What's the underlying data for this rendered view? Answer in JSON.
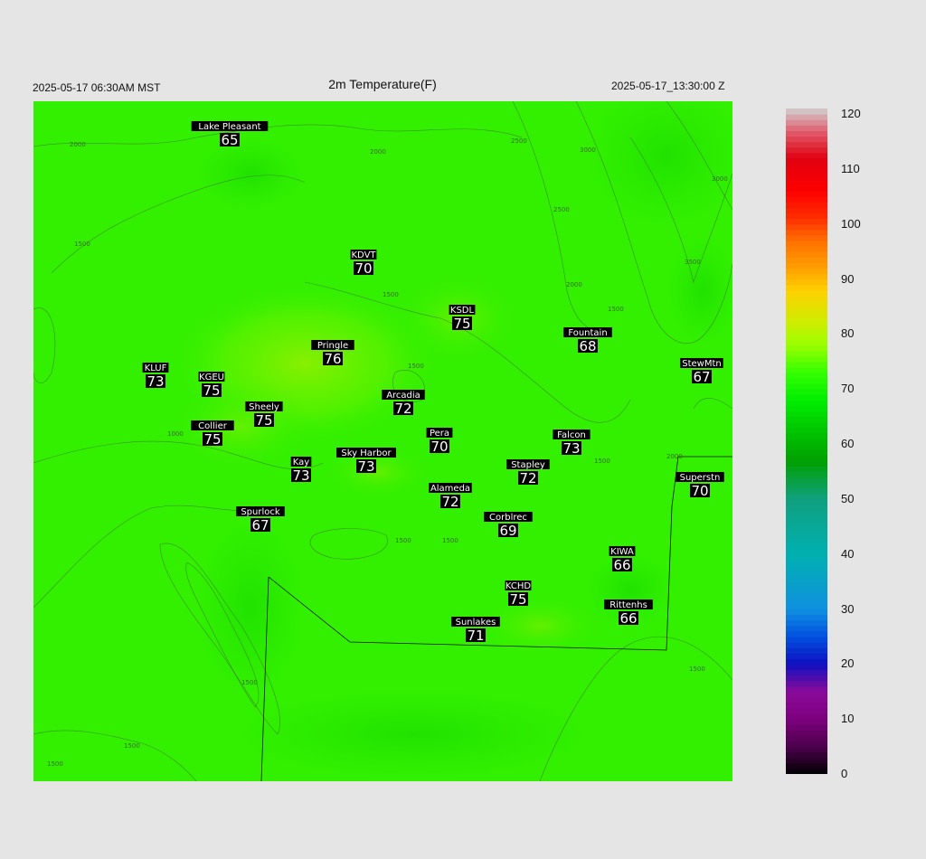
{
  "header": {
    "local_time": "2025-05-17 06:30AM MST",
    "title": "2m Temperature(F)",
    "utc_time": "2025-05-17_13:30:00 Z"
  },
  "colorbar": {
    "ticks": [
      "120",
      "110",
      "100",
      "90",
      "80",
      "70",
      "60",
      "50",
      "40",
      "30",
      "20",
      "10",
      "0"
    ]
  },
  "contour_labels": [
    "2000",
    "2000",
    "2500",
    "3000",
    "1500",
    "2500",
    "3000",
    "1500",
    "2000",
    "3500",
    "1500",
    "1500",
    "1000",
    "1500",
    "2000",
    "1500",
    "1500",
    "1500",
    "1500",
    "1500",
    "1500"
  ],
  "stations": [
    {
      "name": "Lake Pleasant",
      "value": "65"
    },
    {
      "name": "KDVT",
      "value": "70"
    },
    {
      "name": "KSDL",
      "value": "75"
    },
    {
      "name": "Pringle",
      "value": "76"
    },
    {
      "name": "Fountain",
      "value": "68"
    },
    {
      "name": "KLUF",
      "value": "73"
    },
    {
      "name": "KGEU",
      "value": "75"
    },
    {
      "name": "StewMtn",
      "value": "67"
    },
    {
      "name": "Arcadia",
      "value": "72"
    },
    {
      "name": "Sheely",
      "value": "75"
    },
    {
      "name": "Collier",
      "value": "75"
    },
    {
      "name": "Pera",
      "value": "70"
    },
    {
      "name": "Falcon",
      "value": "73"
    },
    {
      "name": "Kay",
      "value": "73"
    },
    {
      "name": "Sky Harbor",
      "value": "73"
    },
    {
      "name": "Stapley",
      "value": "72"
    },
    {
      "name": "Superstn",
      "value": "70"
    },
    {
      "name": "Alameda",
      "value": "72"
    },
    {
      "name": "Spurlock",
      "value": "67"
    },
    {
      "name": "Corblrec",
      "value": "69"
    },
    {
      "name": "KIWA",
      "value": "66"
    },
    {
      "name": "KCHD",
      "value": "75"
    },
    {
      "name": "Rittenhs",
      "value": "66"
    },
    {
      "name": "Sunlakes",
      "value": "71"
    }
  ]
}
